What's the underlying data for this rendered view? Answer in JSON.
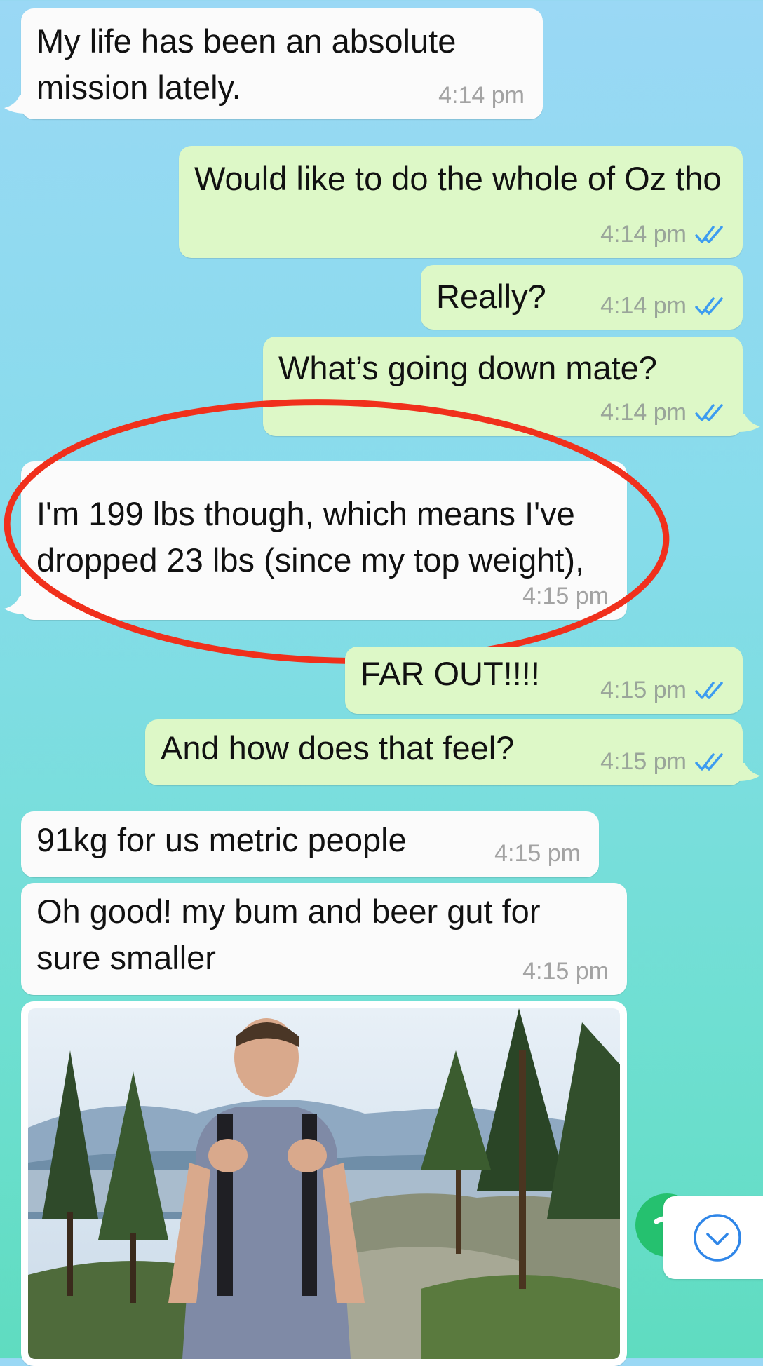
{
  "messages": [
    {
      "id": "m1",
      "dir": "in",
      "text": "My life has been an absolute mission lately.",
      "time": "4:14 pm"
    },
    {
      "id": "m2",
      "dir": "out",
      "text": "Would like to do the whole of Oz tho",
      "time": "4:14 pm",
      "status": "read"
    },
    {
      "id": "m3",
      "dir": "out",
      "text": "Really?",
      "time": "4:14 pm",
      "status": "read"
    },
    {
      "id": "m4",
      "dir": "out",
      "text": "What’s going down mate?",
      "time": "4:14 pm",
      "status": "read"
    },
    {
      "id": "m5",
      "dir": "in",
      "text": "I'm 199 lbs though, which means I've dropped 23 lbs (since my top weight),",
      "time": "4:15 pm",
      "highlighted": true
    },
    {
      "id": "m6",
      "dir": "out",
      "text": "FAR OUT!!!!",
      "time": "4:15 pm",
      "status": "read"
    },
    {
      "id": "m7",
      "dir": "out",
      "text": "And how does that feel?",
      "time": "4:15 pm",
      "status": "read"
    },
    {
      "id": "m8",
      "dir": "in",
      "text": "91kg for us metric people",
      "time": "4:15 pm"
    },
    {
      "id": "m9",
      "dir": "in",
      "text": "Oh good! my bum and beer gut for sure smaller",
      "time": "4:15 pm"
    }
  ],
  "photo": {
    "subject": "man with backpack on forest trail overlooking water"
  },
  "colors": {
    "incoming_bubble": "#fbfbfb",
    "outgoing_bubble": "#ddf8c7",
    "read_ticks": "#3d9cf0",
    "highlight_circle": "#f0301c"
  },
  "icons": {
    "scroll_down": "chevron-down-circle-icon",
    "read_status": "double-check-icon"
  }
}
